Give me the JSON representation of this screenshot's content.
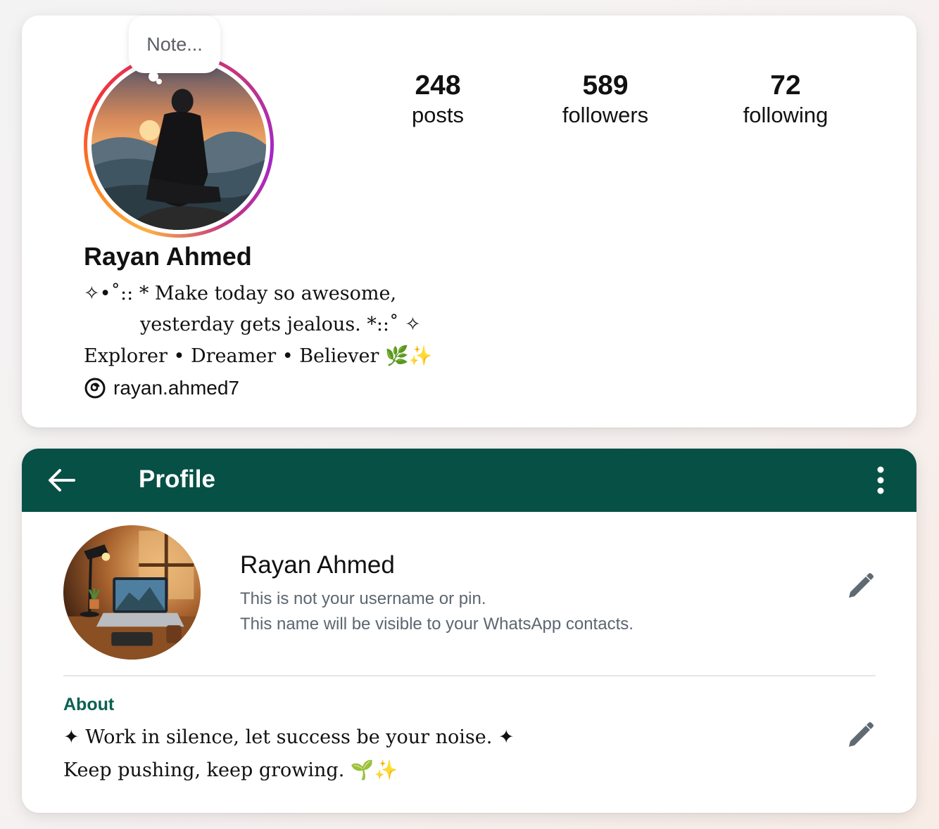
{
  "instagram": {
    "note_placeholder": "Note...",
    "stats": [
      {
        "value": "248",
        "label": "posts"
      },
      {
        "value": "589",
        "label": "followers"
      },
      {
        "value": "72",
        "label": "following"
      }
    ],
    "name": "Rayan Ahmed",
    "bio_line1": "✧•˚:: * Make today so awesome,",
    "bio_line2": "yesterday gets jealous. *::˚ ✧",
    "bio_line3": "Explorer • Dreamer • Believer 🌿✨",
    "threads_handle": "rayan.ahmed7",
    "ring_colors": [
      "#fcb045",
      "#fd7d1d",
      "#e1306c",
      "#c13584"
    ]
  },
  "whatsapp": {
    "header_title": "Profile",
    "header_color": "#075046",
    "name": "Rayan Ahmed",
    "name_hint_line1": "This is not your username or pin.",
    "name_hint_line2": "This name will be visible to your WhatsApp contacts.",
    "about_label": "About",
    "about_line1": "✦ Work in silence, let success be your noise. ✦",
    "about_line2": "Keep pushing, keep growing. 🌱✨",
    "accent_color": "#0b6152"
  },
  "icons": [
    "back-arrow-icon",
    "more-vert-icon",
    "pencil-icon",
    "threads-icon"
  ]
}
